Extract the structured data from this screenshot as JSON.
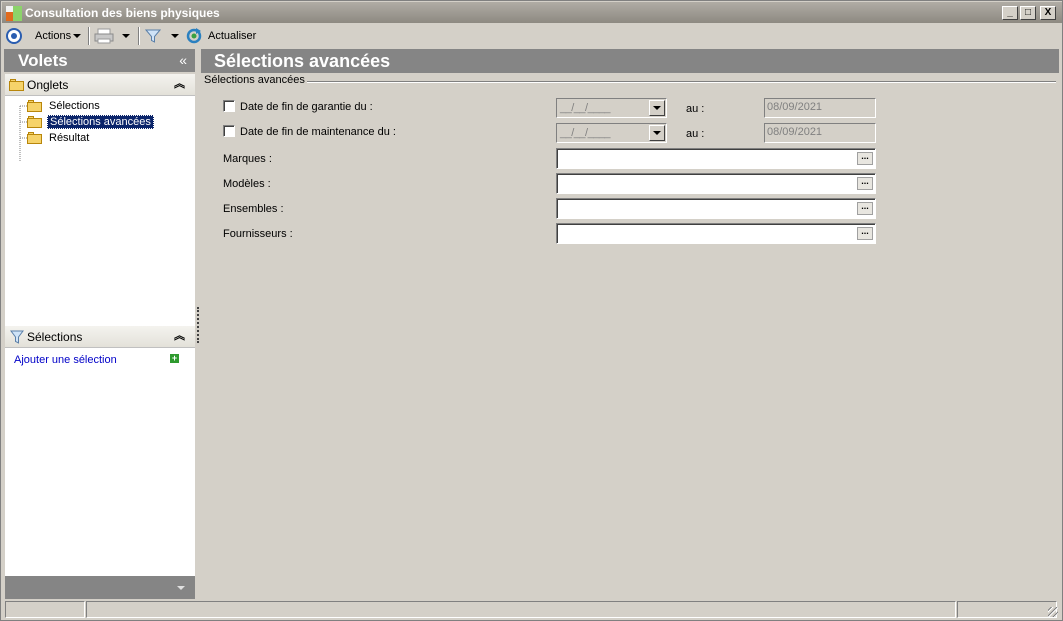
{
  "window": {
    "title": "Consultation des biens physiques",
    "buttons": {
      "minimize": "_",
      "maximize": "□",
      "close": "X"
    }
  },
  "toolbar": {
    "actions_label": "Actions",
    "refresh_label": "Actualiser"
  },
  "left_pane": {
    "title": "Volets",
    "collapse_glyph": "«",
    "tabs_section": {
      "label": "Onglets",
      "chevron": "⌃",
      "items": [
        {
          "label": "Sélections",
          "selected": false
        },
        {
          "label": "Sélections avancées",
          "selected": true
        },
        {
          "label": "Résultat",
          "selected": false
        }
      ]
    },
    "selections_section": {
      "label": "Sélections",
      "chevron": "⌃",
      "add_link": "Ajouter une sélection"
    }
  },
  "main": {
    "title": "Sélections avancées",
    "group_title": "Sélections avancées",
    "warranty": {
      "label": "Date de fin de garantie du :",
      "from_mask": "__/__/____",
      "to_label": "au :",
      "to_value": "08/09/2021"
    },
    "maintenance": {
      "label": "Date de fin de maintenance du :",
      "from_mask": "__/__/____",
      "to_label": "au :",
      "to_value": "08/09/2021"
    },
    "fields": [
      {
        "label": "Marques :",
        "value": ""
      },
      {
        "label": "Modèles :",
        "value": ""
      },
      {
        "label": "Ensembles :",
        "value": ""
      },
      {
        "label": "Fournisseurs :",
        "value": ""
      }
    ],
    "ellipsis": "..."
  },
  "colors": {
    "header_gray": "#858585",
    "window_bg": "#d4d0c8",
    "link_blue": "#0000c8",
    "selection_blue": "#0a246a"
  }
}
